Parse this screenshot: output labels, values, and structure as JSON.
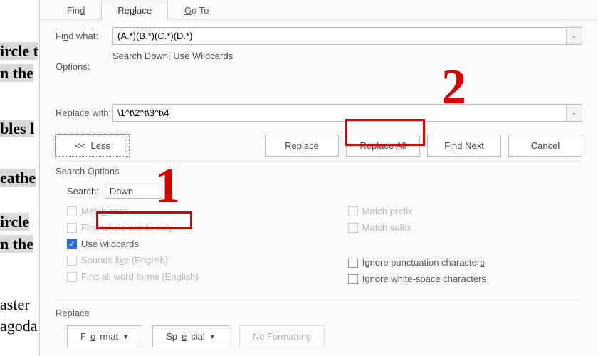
{
  "tabs": {
    "find": "Find",
    "replace": "Replace",
    "goto": "Go To"
  },
  "labels": {
    "find_what": "Find what:",
    "options": "Options:",
    "replace_with": "Replace with:",
    "search_options": "Search Options",
    "search": "Search:",
    "replace_section": "Replace"
  },
  "values": {
    "find_what": "(A.*)(B.*)(C.*)(D.*)",
    "options": "Search Down, Use Wildcards",
    "replace_with": "\\1^t\\2^t\\3^t\\4",
    "search_direction": "Down"
  },
  "buttons": {
    "less": "<<  Less",
    "replace": "Replace",
    "replace_all": "Replace All",
    "find_next": "Find Next",
    "cancel": "Cancel",
    "format": "Format",
    "special": "Special",
    "no_formatting": "No Formatting"
  },
  "checks": {
    "match_case": "Match case",
    "whole_words": "Find whole words only",
    "use_wildcards": "Use wildcards",
    "sounds_like": "Sounds like (English)",
    "word_forms": "Find all word forms (English)",
    "match_prefix": "Match prefix",
    "match_suffix": "Match suffix",
    "ignore_punct": "Ignore punctuation characters",
    "ignore_white": "Ignore white-space characters"
  },
  "annotations": {
    "one": "1",
    "two": "2"
  },
  "bg": {
    "l1": "ircle t",
    "l2": "n the",
    "l3": "bles l",
    "l4": "eathe",
    "l5": "ircle",
    "l6": "n the",
    "l7": "aster",
    "l8": "agoda"
  },
  "underline": {
    "find_d": "d",
    "replace_p": "p",
    "goto_g": "G",
    "find_what_n": "n",
    "replace_with_i": "i",
    "less_l": "L",
    "replace_r": "R",
    "replace_all_a": "A",
    "find_next_f": "F",
    "search_colon": ":",
    "match_case_h": "h",
    "whole_y": "y",
    "wild_u": "U",
    "sounds_k": "k",
    "wordforms_w": "w",
    "prefix_none": "",
    "suffix_none": "",
    "punct_s": "s",
    "white_w": "w",
    "format_o": "o",
    "special_e": "e"
  }
}
